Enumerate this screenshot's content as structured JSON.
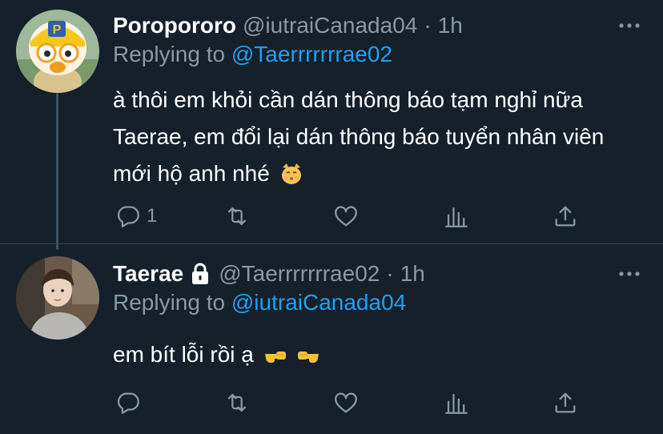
{
  "tweets": [
    {
      "display_name": "Poropororo",
      "handle": "@iutraiCanada04",
      "separator": "·",
      "time": "1h",
      "replying_prefix": "Replying to",
      "replying_to": "@Taerrrrrrrae02",
      "text": "à thôi em khỏi cần dán thông báo tạm nghỉ nữa Taerae, em đổi lại dán thông báo tuyển nhân viên mới hộ anh nhé",
      "emoji": "kissing-cat-face",
      "reply_count": "1",
      "retweet_count": "",
      "like_count": "",
      "protected": false
    },
    {
      "display_name": "Taerae",
      "handle": "@Taerrrrrrrae02",
      "separator": "·",
      "time": "1h",
      "replying_prefix": "Replying to",
      "replying_to": "@iutraiCanada04",
      "text": "em bít lỗi rồi ạ",
      "emoji": "backhand-index-pointing-left-and-right",
      "reply_count": "",
      "retweet_count": "",
      "like_count": "",
      "protected": true
    }
  ],
  "colors": {
    "background": "#15202b",
    "primary_text": "#ffffff",
    "secondary_text": "#8899a6",
    "link": "#1da1f2",
    "thread_line": "#3d5466"
  }
}
